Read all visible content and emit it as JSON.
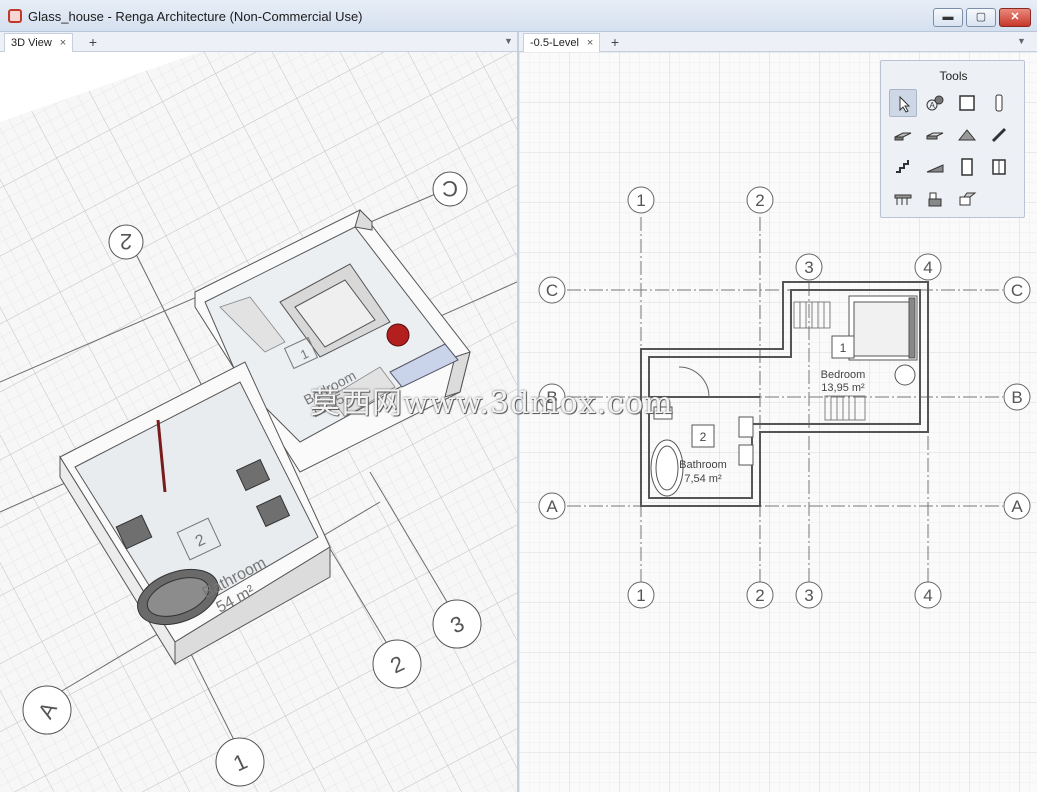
{
  "window": {
    "title": "Glass_house - Renga Architecture (Non-Commercial Use)",
    "minimize_label": "▬",
    "maximize_label": "▢",
    "close_label": "✕"
  },
  "left_pane": {
    "tab_label": "3D View",
    "tab_close": "×",
    "add_tab": "+",
    "menu_arrow": "▼",
    "room1": {
      "number": "1",
      "name": "Bedroom",
      "area": "13,95"
    },
    "room2": {
      "number": "2",
      "name": "Bathroom",
      "area": "54 m²"
    },
    "axes": [
      "2",
      "C",
      "A",
      "1",
      "2",
      "3"
    ]
  },
  "right_pane": {
    "tab_label": "-0.5-Level",
    "tab_close": "×",
    "add_tab": "+",
    "menu_arrow": "▼",
    "grid_numbers_top": [
      "1",
      "2",
      "3",
      "4"
    ],
    "grid_numbers_bottom": [
      "1",
      "2",
      "3",
      "4"
    ],
    "grid_letters": [
      "C",
      "B",
      "A"
    ],
    "room1": {
      "number": "1",
      "name": "Bedroom",
      "area": "13,95 m²"
    },
    "room2": {
      "number": "2",
      "name": "Bathroom",
      "area": "7,54 m²"
    }
  },
  "tools": {
    "title": "Tools",
    "items": [
      "select-icon",
      "model-text-icon",
      "wall-icon",
      "column-icon",
      "slab-icon",
      "beam-icon",
      "roof-icon",
      "railing-icon",
      "stair-icon",
      "ramp-icon",
      "door-icon",
      "window-icon",
      "table-icon",
      "equipment-icon",
      "opening-icon"
    ]
  },
  "watermark": "莫西网www.3dmox.com"
}
